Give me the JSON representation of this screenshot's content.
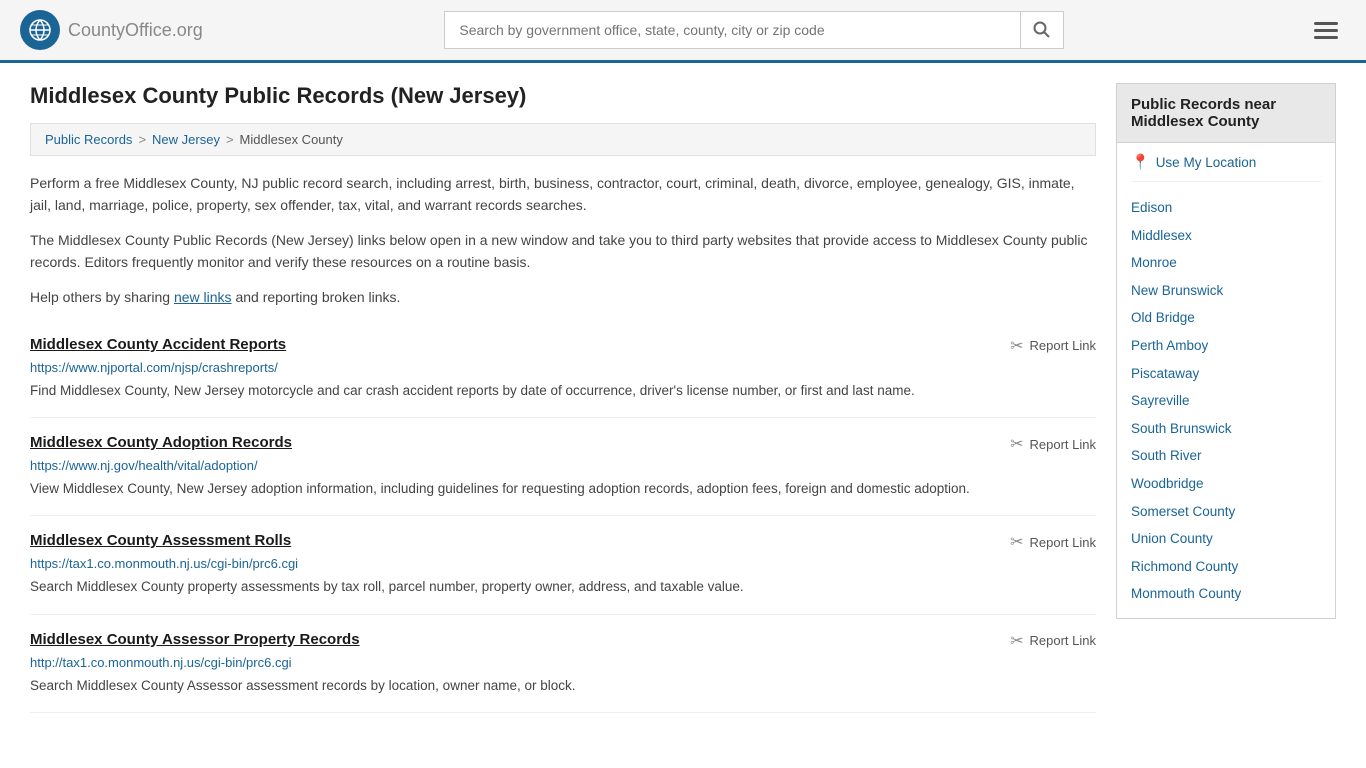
{
  "header": {
    "logo_text": "CountyOffice",
    "logo_suffix": ".org",
    "search_placeholder": "Search by government office, state, county, city or zip code"
  },
  "page": {
    "title": "Middlesex County Public Records (New Jersey)",
    "breadcrumb": {
      "items": [
        "Public Records",
        "New Jersey",
        "Middlesex County"
      ]
    },
    "description1": "Perform a free Middlesex County, NJ public record search, including arrest, birth, business, contractor, court, criminal, death, divorce, employee, genealogy, GIS, inmate, jail, land, marriage, police, property, sex offender, tax, vital, and warrant records searches.",
    "description2": "The Middlesex County Public Records (New Jersey) links below open in a new window and take you to third party websites that provide access to Middlesex County public records. Editors frequently monitor and verify these resources on a routine basis.",
    "description3_pre": "Help others by sharing ",
    "description3_link": "new links",
    "description3_post": " and reporting broken links."
  },
  "records": [
    {
      "title": "Middlesex County Accident Reports",
      "url": "https://www.njportal.com/njsp/crashreports/",
      "description": "Find Middlesex County, New Jersey motorcycle and car crash accident reports by date of occurrence, driver's license number, or first and last name."
    },
    {
      "title": "Middlesex County Adoption Records",
      "url": "https://www.nj.gov/health/vital/adoption/",
      "description": "View Middlesex County, New Jersey adoption information, including guidelines for requesting adoption records, adoption fees, foreign and domestic adoption."
    },
    {
      "title": "Middlesex County Assessment Rolls",
      "url": "https://tax1.co.monmouth.nj.us/cgi-bin/prc6.cgi",
      "description": "Search Middlesex County property assessments by tax roll, parcel number, property owner, address, and taxable value."
    },
    {
      "title": "Middlesex County Assessor Property Records",
      "url": "http://tax1.co.monmouth.nj.us/cgi-bin/prc6.cgi",
      "description": "Search Middlesex County Assessor assessment records by location, owner name, or block."
    }
  ],
  "sidebar": {
    "header_line1": "Public Records near",
    "header_line2": "Middlesex County",
    "use_my_location": "Use My Location",
    "links": [
      "Edison",
      "Middlesex",
      "Monroe",
      "New Brunswick",
      "Old Bridge",
      "Perth Amboy",
      "Piscataway",
      "Sayreville",
      "South Brunswick",
      "South River",
      "Woodbridge",
      "Somerset County",
      "Union County",
      "Richmond County",
      "Monmouth County"
    ]
  },
  "labels": {
    "report_link": "Report Link",
    "separator": ">"
  }
}
